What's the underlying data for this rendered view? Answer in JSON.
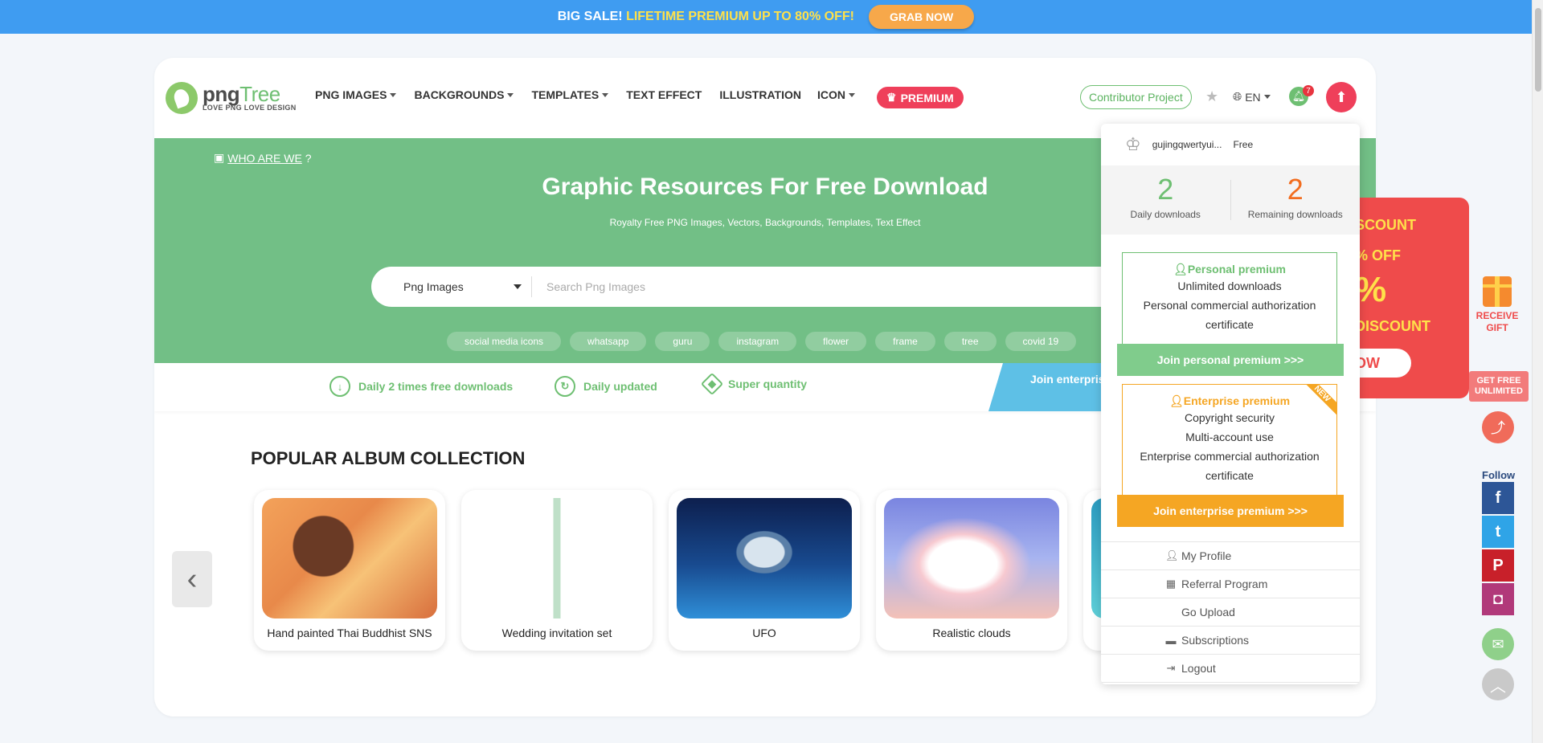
{
  "promo": {
    "big_sale": "BIG SALE!",
    "highlight": "LIFETIME PREMIUM UP TO 80% OFF!",
    "button": "GRAB NOW"
  },
  "logo": {
    "word_a": "png",
    "word_b": "Tree",
    "tagline": "LOVE PNG LOVE DESIGN"
  },
  "nav": {
    "items": [
      {
        "label": "PNG IMAGES",
        "dropdown": true
      },
      {
        "label": "BACKGROUNDS",
        "dropdown": true
      },
      {
        "label": "TEMPLATES",
        "dropdown": true
      },
      {
        "label": "TEXT EFFECT",
        "dropdown": false
      },
      {
        "label": "ILLUSTRATION",
        "dropdown": false
      },
      {
        "label": "ICON",
        "dropdown": true
      }
    ],
    "premium": "PREMIUM",
    "contributor": "Contributor Project",
    "lang": "EN",
    "notification_count": "7"
  },
  "hero": {
    "who_link": "WHO ARE WE",
    "who_suffix": "?",
    "title": "Graphic Resources For Free Download",
    "subtitle": "Royalty Free PNG Images, Vectors, Backgrounds, Templates, Text Effect",
    "search_category": "Png Images",
    "search_placeholder": "Search Png Images",
    "tags": [
      "social media icons",
      "whatsapp",
      "guru",
      "instagram",
      "flower",
      "frame",
      "tree",
      "covid 19"
    ]
  },
  "features": {
    "items": [
      "Daily 2 times free downloads",
      "Daily updated",
      "Super quantity"
    ],
    "join_enterprise": "Join enterprise premium"
  },
  "albums": {
    "title": "POPULAR ALBUM COLLECTION",
    "items": [
      {
        "label": "Hand painted Thai Buddhist SNS"
      },
      {
        "label": "Wedding invitation set"
      },
      {
        "label": "UFO"
      },
      {
        "label": "Realistic clouds"
      }
    ]
  },
  "discount": {
    "line1": "SCOUNT",
    "line2": "% OFF",
    "line3": "%",
    "line4": "DISCOUNT",
    "button": "OW",
    "gift_text": "RECEIVE GIFT",
    "get_free": "GET FREE UNLIMITED",
    "follow": "Follow"
  },
  "user_menu": {
    "username": "gujingqwertyui...",
    "plan": "Free",
    "daily_downloads_value": "2",
    "daily_downloads_label": "Daily downloads",
    "remaining_downloads_value": "2",
    "remaining_downloads_label": "Remaining downloads",
    "personal": {
      "title": "Personal premium",
      "lines": [
        "Unlimited downloads",
        "Personal commercial authorization",
        "certificate"
      ],
      "button": "Join personal premium >>>"
    },
    "enterprise": {
      "title": "Enterprise premium",
      "badge": "NEW",
      "lines": [
        "Copyright security",
        "Multi-account use",
        "Enterprise commercial authorization",
        "certificate"
      ],
      "button": "Join enterprise premium >>>"
    },
    "menu": [
      "My Profile",
      "Referral Program",
      "Go Upload",
      "Subscriptions",
      "Logout"
    ]
  },
  "colors": {
    "brand_green": "#72bf86",
    "premium_red": "#ef3f5a",
    "promo_blue": "#3f9cf1",
    "orange": "#f5a623",
    "remaining_orange": "#f26d1f"
  }
}
